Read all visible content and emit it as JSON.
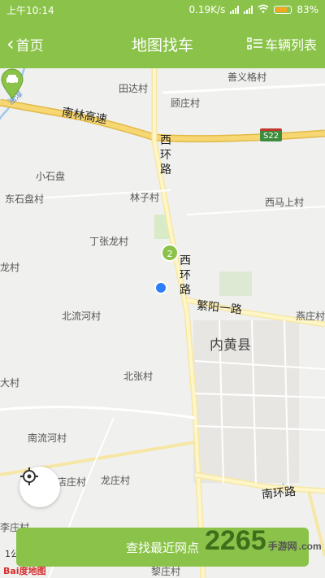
{
  "status_bar": {
    "time": "上午10:14",
    "speed": "0.19K/s",
    "battery_pct": "83%",
    "battery_level": 0.83,
    "battery_color": "#f5a623"
  },
  "navbar": {
    "back_label": "首页",
    "title": "地图找车",
    "list_label": "车辆列表",
    "color": "#8bc34a"
  },
  "map": {
    "labels": {
      "tianda": "田达村",
      "shanyige": "善义格村",
      "guzhuang": "顾庄村",
      "nanlin": "南林高速",
      "xihuan_top": "西环路",
      "xiaoshipan": "小石盘",
      "dongshipan": "东石盘村",
      "linzi": "林子村",
      "ximashang": "西马上村",
      "dingzhanglong": "丁张龙村",
      "xihuan_mid": "西环路",
      "long_cut": "龙村",
      "fanyang": "繁阳一路",
      "yanzhuang": "燕庄村",
      "beiliuhe": "北流河村",
      "neihuang": "内黄县",
      "da_cut": "大村",
      "beizhang": "北张村",
      "nanliuhe": "南流河村",
      "dian_cut": "店庄村",
      "longzhuang": "龙庄村",
      "nanhuan": "南环路",
      "li_cut": "李庄村",
      "lizhuang": "黎庄村",
      "river": "浊漳"
    },
    "highway_shield": "S22",
    "marker_count": "2",
    "scale_text": "1公",
    "baidu_logo": "Bai度地图"
  },
  "buttons": {
    "find_nearest": "查找最近网点"
  },
  "watermark": {
    "number": "2265",
    "site": "手游网",
    "suffix": ".com"
  },
  "colors": {
    "brand": "#8bc34a",
    "highway": "#f2c94c",
    "location": "#2d7ff9"
  }
}
